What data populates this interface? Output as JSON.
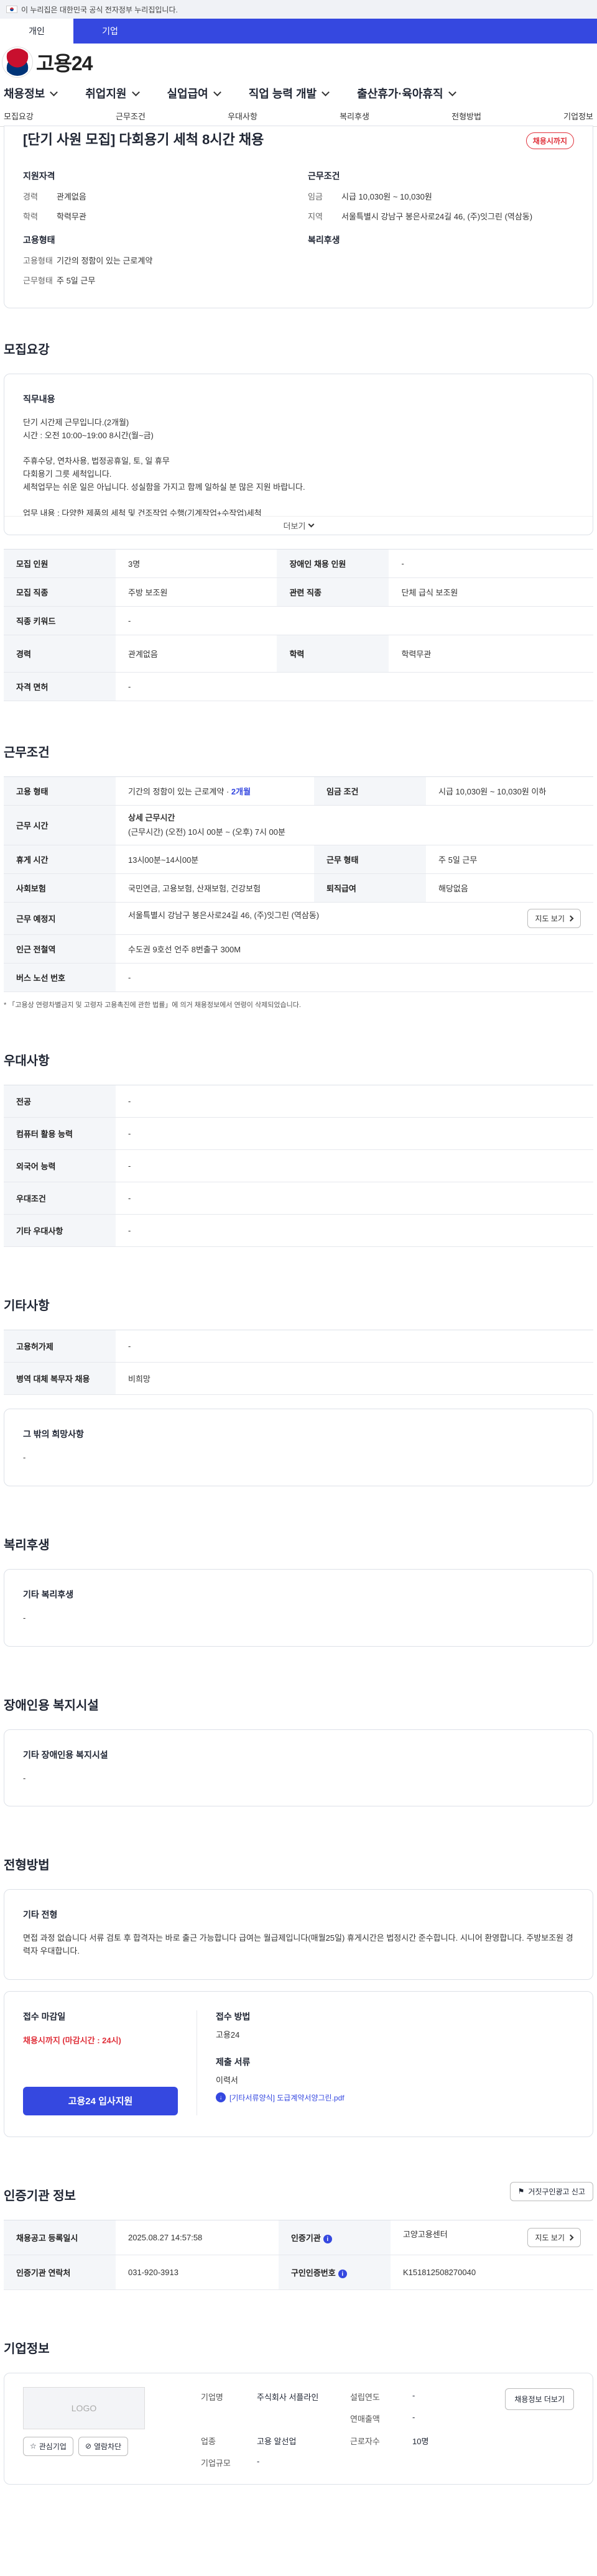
{
  "gov_banner": {
    "text": "이 누리집은 대한민국 공식 전자정부 누리집입니다."
  },
  "user_tabs": [
    "개인",
    "기업"
  ],
  "logo": {
    "text": "고용24"
  },
  "main_menu": [
    "채용정보",
    "취업지원",
    "실업급여",
    "직업 능력 개발",
    "출산휴가·육아휴직"
  ],
  "anchor_nav": [
    "모집요강",
    "근무조건",
    "우대사항",
    "복리후생",
    "전형방법",
    "기업정보"
  ],
  "summary": {
    "title": "[단기 사원 모집] 다회용기 세척 8시간 채용",
    "status": "채용시까지",
    "qualification_title": "지원자격",
    "qualification": [
      {
        "k": "경력",
        "v": "관계없음"
      },
      {
        "k": "학력",
        "v": "학력무관"
      }
    ],
    "condition_title": "근무조건",
    "condition": [
      {
        "k": "임금",
        "v": "시급 10,030원 ~ 10,030원"
      },
      {
        "k": "지역",
        "v": "서울특별시 강남구 봉은사로24길 46, (주)잇그린 (역삼동)"
      }
    ],
    "employment_title": "고용형태",
    "employment": [
      {
        "k": "고용형태",
        "v": "기간의 정함이 있는 근로계약"
      },
      {
        "k": "근무형태",
        "v": "주 5일 근무"
      }
    ],
    "welfare_title": "복리후생"
  },
  "recruit": {
    "section_title": "모집요강",
    "job_title": "직무내용",
    "job_body": "단기 시간제 근무입니다.(2개월)\n시간 : 오전 10:00~19:00 8시간(월~금)\n\n주휴수당, 연차사용, 법정공휴일, 토, 일 휴무\n다회용기 그릇 세척입니다.\n세척업무는 쉬운 일은 아닙니다. 성실함을 가지고 함께 일하실 분 많은 지원 바랍니다.\n\n업무 내용 : 다양한 제품의 세척 및 건조작업 수행(기계작업+수작업)세척\n공정에서의 품질 검사 및 관리",
    "more": "더보기",
    "rows": {
      "headcount_k": "모집 인원",
      "headcount_v": "3명",
      "disabled_k": "장애인 채용 인원",
      "disabled_v": "-",
      "job_k": "모집 직종",
      "job_v": "주방 보조원",
      "rel_k": "관련 직종",
      "rel_v": "단체 급식 보조원",
      "kw_k": "직종 키워드",
      "kw_v": "-",
      "career_k": "경력",
      "career_v": "관계없음",
      "edu_k": "학력",
      "edu_v": "학력무관",
      "license_k": "자격 면허",
      "license_v": "-"
    }
  },
  "work": {
    "section_title": "근무조건",
    "emp_k": "고용 형태",
    "emp_v": "기간의 정함이 있는 근로계약 · ",
    "emp_period": "2개월",
    "wage_k": "임금 조건",
    "wage_v": "시급 10,030원 ~ 10,030원 이하",
    "time_k": "근무 시간",
    "time_detail_h": "상세 근무시간",
    "time_detail_v": "(근무시간) (오전) 10시 00분 ~ (오후) 7시 00분",
    "rest_k": "휴게 시간",
    "rest_v": "13시00분~14시00분",
    "type_k": "근무 형태",
    "type_v": "주 5일 근무",
    "ins_k": "사회보험",
    "ins_v": "국민연금, 고용보험, 산재보험, 건강보험",
    "ret_k": "퇴직급여",
    "ret_v": "해당없음",
    "place_k": "근무 예정지",
    "place_v": "서울특별시 강남구 봉은사로24길 46, (주)잇그린 (역삼동)",
    "map_btn": "지도 보기",
    "subway_k": "인근 전철역",
    "subway_v": "수도권 9호선 언주 8번출구 300M",
    "bus_k": "버스 노선 번호",
    "bus_v": "-",
    "note": "* 「고용상 연령차별금지 및 고령자 고용촉진에 관한 법률」에 의거 채용정보에서 연령이 삭제되었습니다."
  },
  "prefer": {
    "section_title": "우대사항",
    "rows": [
      {
        "k": "전공",
        "v": "-"
      },
      {
        "k": "컴퓨터 활용 능력",
        "v": "-"
      },
      {
        "k": "외국어 능력",
        "v": "-"
      },
      {
        "k": "우대조건",
        "v": "-"
      },
      {
        "k": "기타 우대사항",
        "v": "-"
      }
    ]
  },
  "etc": {
    "section_title": "기타사항",
    "rows": [
      {
        "k": "고용허가제",
        "v": "-"
      },
      {
        "k": "병역 대체 복무자 채용",
        "v": "비희망"
      }
    ],
    "card_h": "그 밖의 희망사항",
    "card_v": "-"
  },
  "welfare": {
    "section_title": "복리후생",
    "card_h": "기타 복리후생",
    "card_v": "-"
  },
  "facility": {
    "section_title": "장애인용 복지시설",
    "card_h": "기타 장애인용 복지시설",
    "card_v": "-"
  },
  "process": {
    "section_title": "전형방법",
    "card_h": "기타 전형",
    "card_v": "면접 과정 없습니다 서류 검토 후 합격자는 바로 출근 가능합니다 급여는 월급제입니다(매월25일) 휴게시간은 법정시간 준수합니다. 시니어 환영합니다. 주방보조원 경력자 우대합니다."
  },
  "apply": {
    "deadline_h": "접수 마감일",
    "deadline_v": "채용시까지 (마감시간 : 24시)",
    "apply_btn": "고용24 입사지원",
    "method_h": "접수 방법",
    "method_v": "고용24",
    "docs_h": "제출 서류",
    "docs_v": "이력서",
    "file": "[기타서류양식] 도급계약서양그린.pdf"
  },
  "cert": {
    "section_title": "인증기관 정보",
    "report_btn": "거짓구인광고 신고",
    "reg_k": "채용공고 등록일시",
    "reg_v": "2025.08.27 14:57:58",
    "org_k": "인증기관",
    "org_v": "고양고용센터",
    "map_btn": "지도 보기",
    "tel_k": "인증기관 연락처",
    "tel_v": "031-920-3913",
    "no_k": "구인인증번호",
    "no_v": "K151812508270040"
  },
  "company": {
    "section_title": "기업정보",
    "logo_text": "LOGO",
    "fav_btn": "관심기업",
    "block_btn": "열람차단",
    "recruit_btn": "채용정보 더보기",
    "name_k": "기업명",
    "name_v": "주식회사 서플라인",
    "year_k": "설립연도",
    "year_v": "-",
    "sales_k": "연매출액",
    "sales_v": "-",
    "ind_k": "업종",
    "ind_v": "고용 알선업",
    "emp_k": "근로자수",
    "emp_v": "10명",
    "size_k": "기업규모",
    "size_v": "-"
  }
}
